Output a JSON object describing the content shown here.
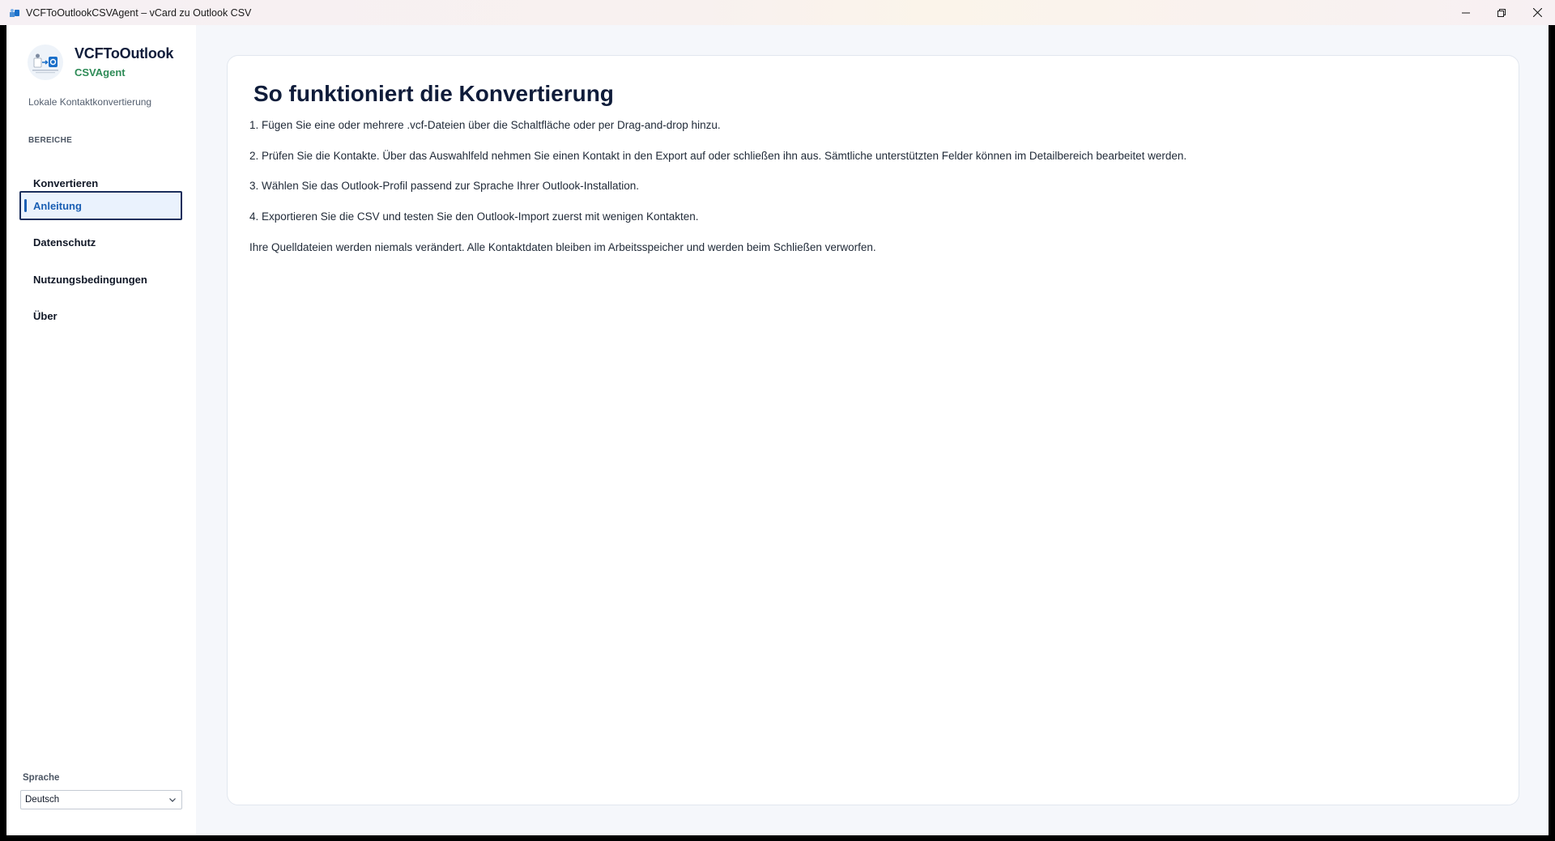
{
  "window": {
    "title": "VCFToOutlookCSVAgent – vCard zu Outlook CSV"
  },
  "sidebar": {
    "brand_title": "VCFToOutlook",
    "brand_subtitle": "CSVAgent",
    "tagline": "Lokale Kontaktkonvertierung",
    "section_label": "BEREICHE",
    "items": [
      {
        "label": "Konvertieren",
        "active": false
      },
      {
        "label": "Anleitung",
        "active": true
      },
      {
        "label": "Datenschutz",
        "active": false
      },
      {
        "label": "Nutzungsbedingungen",
        "active": false
      },
      {
        "label": "Über",
        "active": false
      }
    ],
    "language_label": "Sprache",
    "language_value": "Deutsch"
  },
  "main": {
    "title": "So funktioniert die Konvertierung",
    "steps": [
      "1. Fügen Sie eine oder mehrere .vcf-Dateien über die Schaltfläche oder per Drag-and-drop hinzu.",
      "2. Prüfen Sie die Kontakte. Über das Auswahlfeld nehmen Sie einen Kontakt in den Export auf oder schließen ihn aus. Sämtliche unterstützten Felder können im Detailbereich bearbeitet werden.",
      "3. Wählen Sie das Outlook-Profil passend zur Sprache Ihrer Outlook-Installation.",
      "4. Exportieren Sie die CSV und testen Sie den Outlook-Import zuerst mit wenigen Kontakten.",
      "Ihre Quelldateien werden niemals verändert. Alle Kontaktdaten bleiben im Arbeitsspeicher und werden beim Schließen verworfen."
    ]
  },
  "colors": {
    "accent": "#1a5fb4",
    "brand_green": "#2e8b57",
    "heading": "#0f1c3a"
  },
  "icons": [
    "app-icon",
    "minimize-icon",
    "restore-icon",
    "close-icon",
    "logo-icon",
    "chevron-down-icon"
  ]
}
